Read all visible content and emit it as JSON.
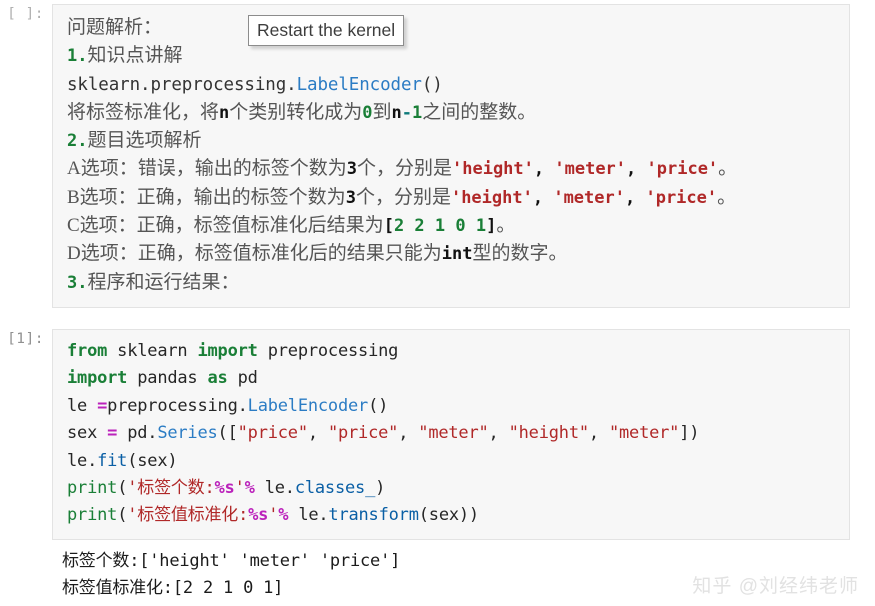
{
  "app": "jupyter-notebook",
  "tooltip": {
    "label": "Restart the kernel"
  },
  "cells": [
    {
      "prompt": "[ ]:",
      "type": "markdown-output",
      "lines": [
        "问题解析：",
        "1.知识点讲解",
        "sklearn.preprocessing.LabelEncoder()",
        "将标签标准化，将n个类别转化成为0到n-1之间的整数。",
        "2.题目选项解析",
        "A选项：错误，输出的标签个数为3个，分别是'height', 'meter', 'price'。",
        "B选项：正确，输出的标签个数为3个，分别是'height', 'meter', 'price'。",
        "C选项：正确，标签值标准化后结果为[2 2 1 0 1]。",
        "D选项：正确，标签值标准化后的结果只能为int型的数字。",
        "3.程序和运行结果："
      ]
    },
    {
      "prompt": "[1]:",
      "type": "code",
      "lines": [
        "from sklearn import preprocessing",
        "import pandas as pd",
        "le =preprocessing.LabelEncoder()",
        "sex = pd.Series([\"price\", \"price\", \"meter\", \"height\", \"meter\"])",
        "le.fit(sex)",
        "print('标签个数:%s'% le.classes_)",
        "print('标签值标准化:%s'% le.transform(sex))"
      ]
    }
  ],
  "output": {
    "lines": [
      "标签个数:['height' 'meter' 'price']",
      "标签值标准化:[2 2 1 0 1]"
    ]
  },
  "watermark": {
    "text": "知乎 @刘经纬老师"
  },
  "md_text": {
    "title": "问题解析：",
    "n1": "1.",
    "t1": "知识点讲解",
    "api_mod": "sklearn.preprocessing.",
    "api_cls": "LabelEncoder",
    "api_paren": "()",
    "l3a": "将标签标准化，将",
    "l3n": "n",
    "l3b": "个类别转化成为",
    "l3zero": "0",
    "l3c": "到",
    "l3n2": "n",
    "l3minus": "-",
    "l3one": "1",
    "l3d": "之间的整数。",
    "n2": "2.",
    "t2": "题目选项解析",
    "optA_head": "A选项：错误，输出的标签个数为",
    "optA_cnt": "3",
    "optA_mid": "个，分别是",
    "optA_s1": "'height'",
    "optA_c1": ", ",
    "optA_s2": "'meter'",
    "optA_c2": ", ",
    "optA_s3": "'price'",
    "optA_end": "。",
    "optB_head": "B选项：正确，输出的标签个数为",
    "optB_cnt": "3",
    "optB_mid": "个，分别是",
    "optB_s1": "'height'",
    "optB_c1": ", ",
    "optB_s2": "'meter'",
    "optB_c2": ", ",
    "optB_s3": "'price'",
    "optB_end": "。",
    "optC_head": "C选项：正确，标签值标准化后结果为",
    "optC_lb": "[",
    "optC_vals": "2 2 1 0 1",
    "optC_rb": "]",
    "optC_end": "。",
    "optD_head": "D选项：正确，标签值标准化后的结果只能为",
    "optD_type": "int",
    "optD_end": "型的数字。",
    "n3": "3.",
    "t3": "程序和运行结果："
  },
  "code_text": {
    "l1_kw1": "from",
    "l1_mod": " sklearn ",
    "l1_kw2": "import",
    "l1_name": " preprocessing",
    "l2_kw1": "import",
    "l2_name": " pandas ",
    "l2_kw2": "as",
    "l2_alias": " pd",
    "l3_var": "le ",
    "l3_op": "=",
    "l3_mod": "preprocessing.",
    "l3_cls": "LabelEncoder",
    "l3_paren": "()",
    "l4_var": "sex ",
    "l4_op": "=",
    "l4_mod": " pd.",
    "l4_cls": "Series",
    "l4_open": "([",
    "l4_s1": "\"price\"",
    "l4_c1": ", ",
    "l4_s2": "\"price\"",
    "l4_c2": ", ",
    "l4_s3": "\"meter\"",
    "l4_c3": ", ",
    "l4_s4": "\"height\"",
    "l4_c4": ", ",
    "l4_s5": "\"meter\"",
    "l4_close": "])",
    "l5_obj": "le.",
    "l5_fn": "fit",
    "l5_args": "(sex)",
    "l6_print": "print",
    "l6_open": "(",
    "l6_str1": "'标签个数:",
    "l6_fmt": "%s",
    "l6_str2": "'",
    "l6_pct": "%",
    "l6_obj": " le.",
    "l6_attr": "classes_",
    "l6_close": ")",
    "l7_print": "print",
    "l7_open": "(",
    "l7_str1": "'标签值标准化:",
    "l7_fmt": "%s",
    "l7_str2": "'",
    "l7_pct": "%",
    "l7_obj": " le.",
    "l7_attr": "transform",
    "l7_args": "(sex))"
  },
  "colors": {
    "keyword": "#1a7f37",
    "class": "#2b7cc4",
    "string": "#b02828",
    "operator": "#bb22bb",
    "cell_bg": "#f7f7f7",
    "cell_border": "#e3e3e3",
    "text": "#555555",
    "watermark": "#e2e2e2"
  }
}
